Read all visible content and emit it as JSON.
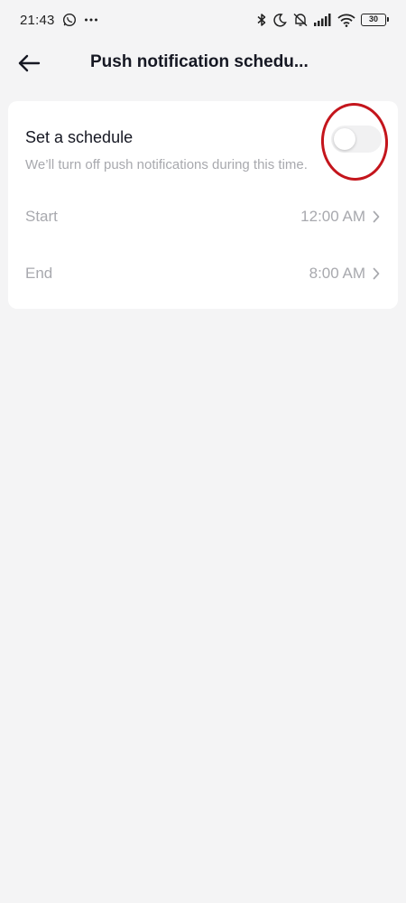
{
  "status_bar": {
    "time": "21:43",
    "battery": "30",
    "icons": [
      "whatsapp-icon",
      "more-dots-icon",
      "bluetooth-icon",
      "moon-icon",
      "muted-icon",
      "signal-icon",
      "wifi-icon",
      "battery-icon"
    ]
  },
  "header": {
    "title": "Push notification schedu..."
  },
  "schedule": {
    "title": "Set a schedule",
    "description": "We’ll turn off push notifications during this time.",
    "toggle_on": false
  },
  "rows": {
    "start": {
      "label": "Start",
      "value": "12:00 AM"
    },
    "end": {
      "label": "End",
      "value": "8:00 AM"
    }
  },
  "colors": {
    "background": "#f4f4f5",
    "card": "#ffffff",
    "muted_text": "#a8a9ae",
    "annotation": "#c4151c"
  }
}
